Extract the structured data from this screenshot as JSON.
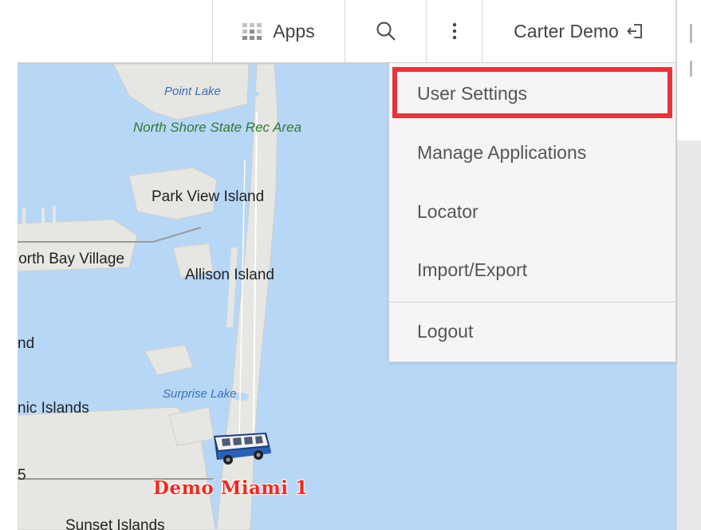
{
  "header": {
    "apps_label": "Apps",
    "user_label": "Carter Demo"
  },
  "menu": {
    "items": [
      {
        "label": "User Settings",
        "highlighted": true
      },
      {
        "label": "Manage Applications"
      },
      {
        "label": "Locator"
      },
      {
        "label": "Import/Export"
      },
      {
        "label": "Logout"
      }
    ]
  },
  "map": {
    "labels": {
      "point_lake": "Point Lake",
      "north_shore": "North Shore State Rec Area",
      "park_view": "Park View Island",
      "north_bay": "lorth Bay Village",
      "allison": "Allison Island",
      "nd": "nd",
      "surprise_lake": "Surprise Lake",
      "nic_islands": "nic Islands",
      "five": "5",
      "sunset": "Sunset Islands"
    },
    "vehicle_label": "Demo Miami 1"
  },
  "colors": {
    "water": "#b7d7f7",
    "land": "#e6e6e3",
    "highlight": "#e8333a",
    "vehicle_label": "#f3281e"
  },
  "icons": {
    "apps": "grid-icon",
    "search": "search-icon",
    "more": "kebab-icon",
    "logout": "logout-icon",
    "vehicle": "bus-icon"
  }
}
